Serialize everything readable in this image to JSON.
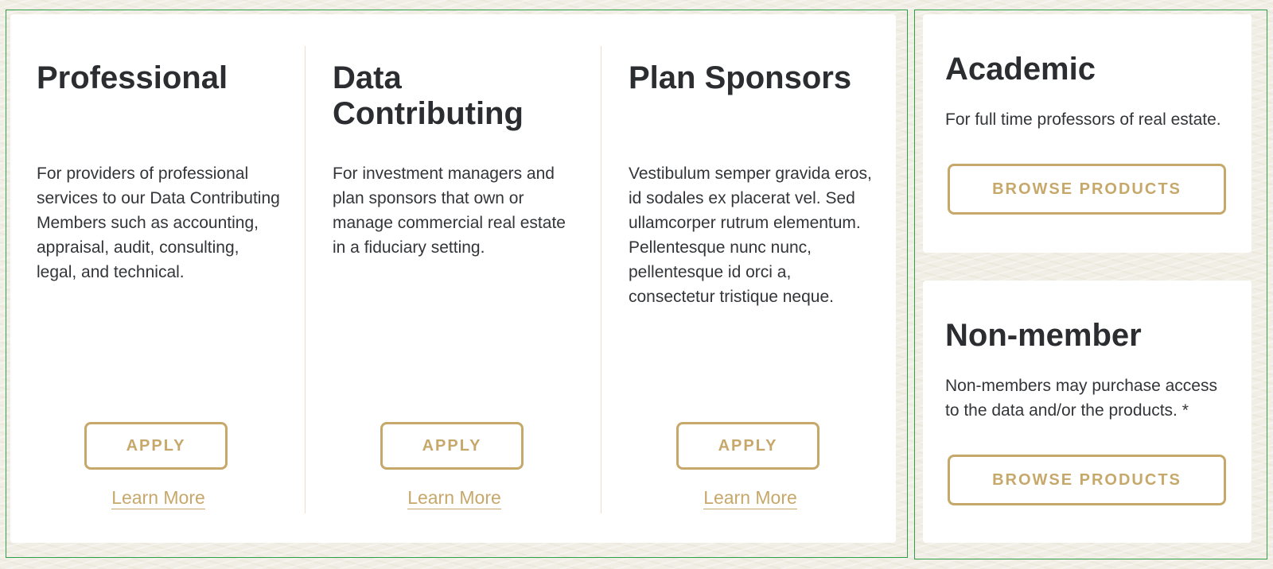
{
  "membership_columns": [
    {
      "title": "Professional",
      "description": "For providers of professional services to our Data Contributing Members such as accounting, appraisal, audit, consulting, legal, and technical.",
      "button_label": "APPLY",
      "link_label": "Learn More"
    },
    {
      "title": "Data Contributing",
      "description": "For investment managers and plan sponsors that own or manage commercial real estate in a fiduciary setting.",
      "button_label": "APPLY",
      "link_label": "Learn More"
    },
    {
      "title": "Plan Sponsors",
      "description": "Vestibulum semper gravida eros, id sodales ex placerat vel. Sed ullamcorper rutrum elementum. Pellentesque nunc nunc, pellentesque id orci a, consectetur tristique neque.",
      "button_label": "APPLY",
      "link_label": "Learn More"
    }
  ],
  "side_cards": [
    {
      "title": "Academic",
      "description": "For full time professors of real estate.",
      "button_label": "BROWSE PRODUCTS"
    },
    {
      "title": "Non-member",
      "description": "Non-members may purchase access to the data and/or the products. *",
      "button_label": "BROWSE PRODUCTS"
    }
  ],
  "colors": {
    "accent_gold": "#c7a86b",
    "heading_text": "#2b2d30",
    "body_text": "#333538",
    "outline_green": "#2f9f4a",
    "page_background": "#f1eee5",
    "divider": "#eadfcf"
  }
}
